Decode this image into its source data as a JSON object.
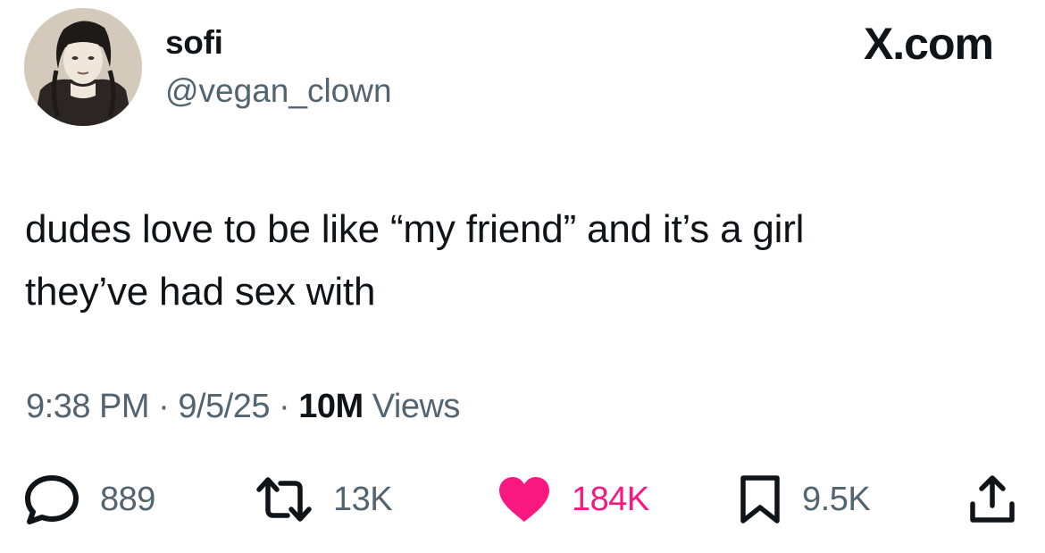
{
  "author": {
    "display_name": "sofi",
    "handle": "@vegan_clown",
    "avatar": "profile-photo"
  },
  "site_logo": "X.com",
  "tweet": {
    "text_line_1": "dudes love to be like “my friend” and it’s a girl",
    "text_line_2": "they’ve had sex with"
  },
  "meta": {
    "time": "9:38 PM",
    "separator": "·",
    "date": "9/5/25",
    "views_count": "10M",
    "views_label": "Views"
  },
  "actions": {
    "reply": {
      "icon": "reply-icon",
      "count": "889"
    },
    "repost": {
      "icon": "repost-icon",
      "count": "13K"
    },
    "like": {
      "icon": "heart-icon",
      "count": "184K",
      "liked": true
    },
    "bookmark": {
      "icon": "bookmark-icon",
      "count": "9.5K"
    },
    "share": {
      "icon": "share-icon"
    }
  },
  "colors": {
    "text": "#0f1419",
    "secondary": "#536471",
    "like": "#f91880"
  }
}
